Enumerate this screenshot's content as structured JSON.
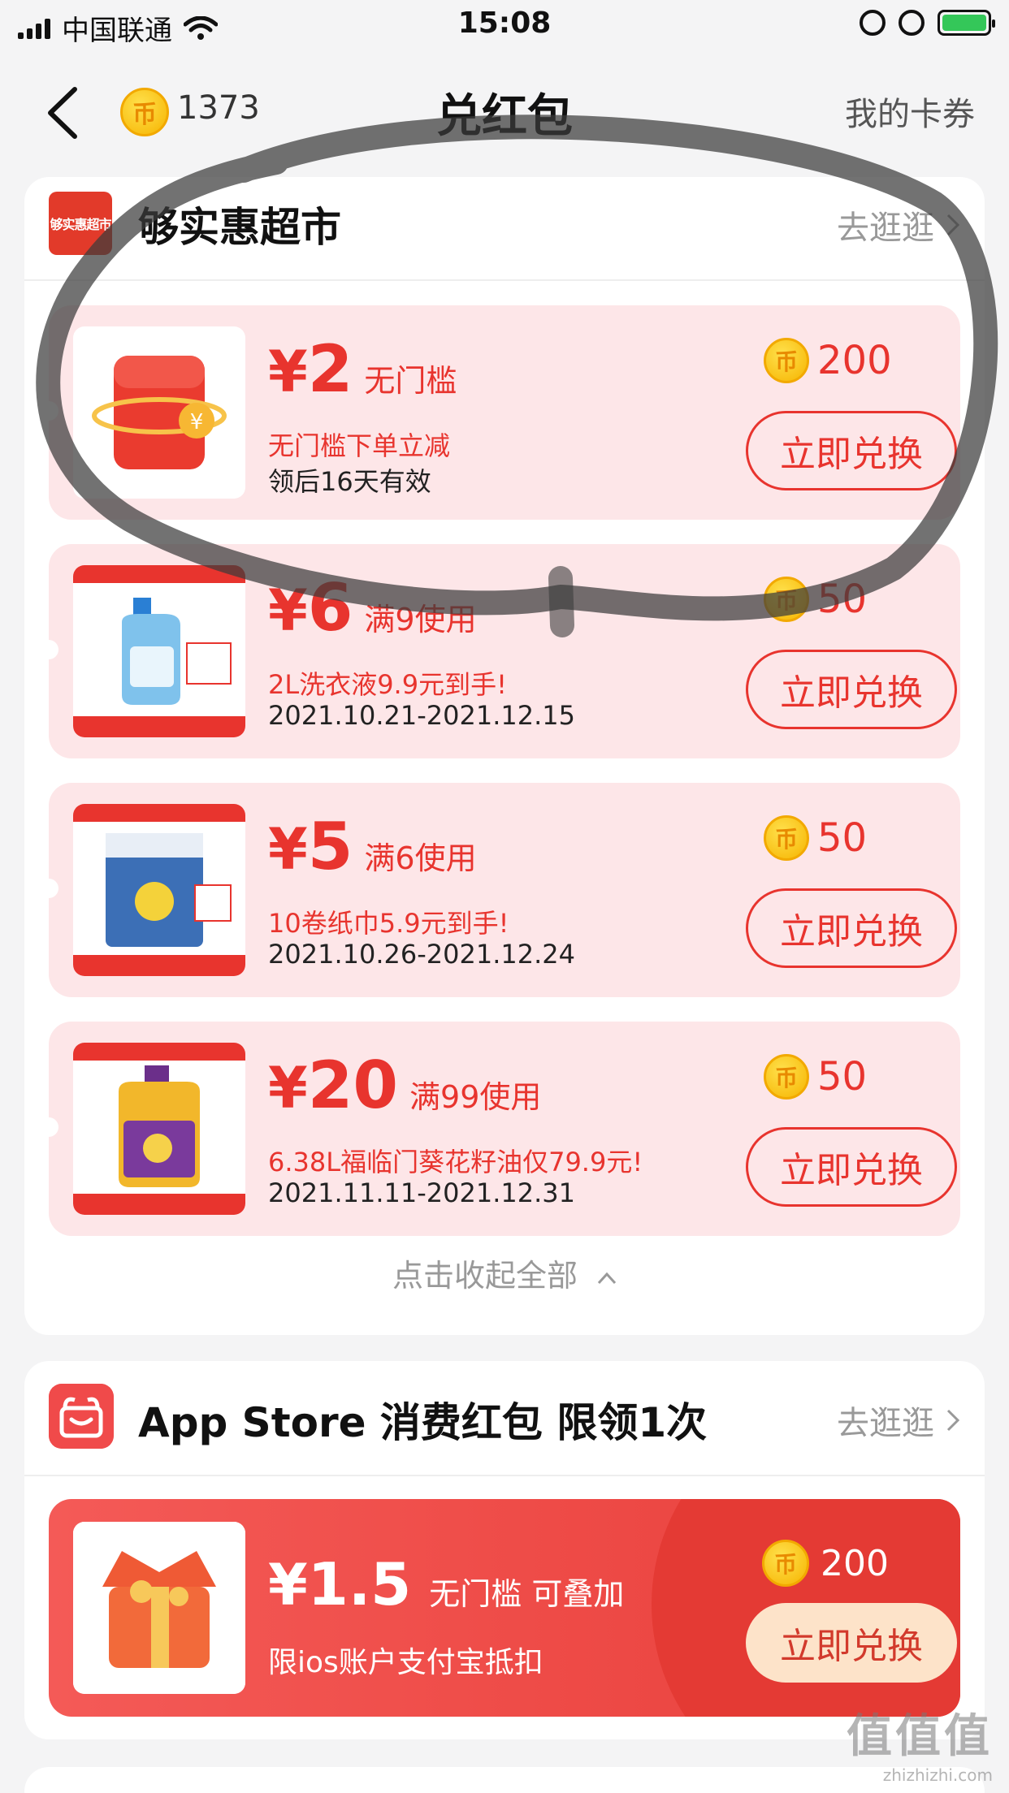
{
  "status_bar": {
    "carrier": "中国联通",
    "time": "15:08"
  },
  "nav": {
    "coin_count": "1373",
    "title": "兑红包",
    "right_link": "我的卡券"
  },
  "store_section": {
    "logo_text": "够实惠超市",
    "title": "够实惠超市",
    "go_link": "去逛逛",
    "coupons": [
      {
        "amount": "2",
        "condition": "无门槛",
        "desc": "无门槛下单立减",
        "validity": "领后16天有效",
        "price": "200",
        "button": "立即兑换"
      },
      {
        "amount": "6",
        "condition": "满9使用",
        "desc": "2L洗衣液9.9元到手!",
        "validity": "2021.10.21-2021.12.15",
        "price": "50",
        "button": "立即兑换"
      },
      {
        "amount": "5",
        "condition": "满6使用",
        "desc": "10卷纸巾5.9元到手!",
        "validity": "2021.10.26-2021.12.24",
        "price": "50",
        "button": "立即兑换"
      },
      {
        "amount": "20",
        "condition": "满99使用",
        "desc": "6.38L福临门葵花籽油仅79.9元!",
        "validity": "2021.11.11-2021.12.31",
        "price": "50",
        "button": "立即兑换"
      }
    ],
    "collapse_label": "点击收起全部"
  },
  "app_section": {
    "title": "App Store 消费红包 限领1次",
    "go_link": "去逛逛",
    "coupon": {
      "amount": "1.5",
      "condition": "无门槛 可叠加",
      "desc": "限ios账户支付宝抵扣",
      "price": "200",
      "button": "立即兑换"
    }
  },
  "currency_symbol": "¥",
  "watermark": {
    "big": "值值值",
    "small": "zhizhizhi.com"
  },
  "colors": {
    "accent_red": "#e8342e",
    "coupon_bg": "#fde6e8",
    "coin_gold": "#f6b400"
  },
  "icons": [
    "back-chevron-icon",
    "coin-icon",
    "wifi-icon",
    "battery-icon",
    "chevron-right-icon",
    "caret-up-icon",
    "gift-box-icon"
  ]
}
